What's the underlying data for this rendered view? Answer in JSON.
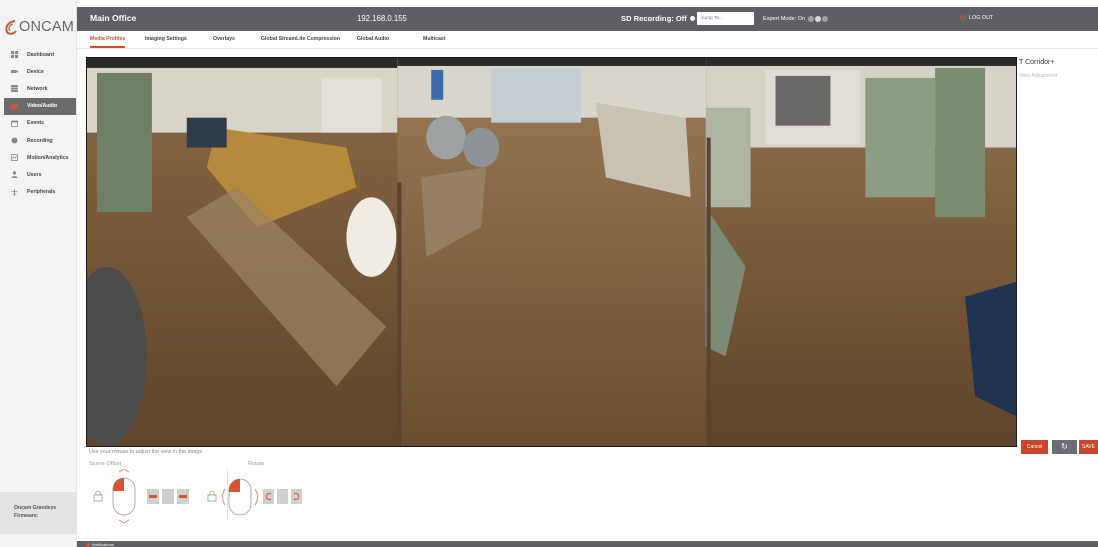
{
  "brand": {
    "logo_text": "ONCAM",
    "accent": "#cf4e2b"
  },
  "sidebar": {
    "items": [
      {
        "label": "Dashboard",
        "icon": "grid-icon",
        "active": false
      },
      {
        "label": "Device",
        "icon": "camera-icon",
        "active": false
      },
      {
        "label": "Network",
        "icon": "network-icon",
        "active": false
      },
      {
        "label": "Video/Audio",
        "icon": "video-icon",
        "active": true
      },
      {
        "label": "Events",
        "icon": "calendar-icon",
        "active": false
      },
      {
        "label": "Recording",
        "icon": "record-icon",
        "active": false
      },
      {
        "label": "Motion/Analytics",
        "icon": "motion-icon",
        "active": false
      },
      {
        "label": "Users",
        "icon": "user-icon",
        "active": false
      },
      {
        "label": "Peripherals",
        "icon": "peripherals-icon",
        "active": false
      }
    ],
    "footer": {
      "device_label": "Oncam Grandeye",
      "firmware_label": "Firmware:"
    }
  },
  "header": {
    "site_name": "Main Office",
    "ip_address": "192.168.0.155",
    "sd_recording": "SD Recording: Off",
    "jump_placeholder": "Jump To...",
    "expert_mode": "Expert Mode: On",
    "logout": "LOG OUT"
  },
  "tabs": [
    {
      "label": "Media Profiles",
      "active": true
    },
    {
      "label": "Imaging Settings",
      "active": false
    },
    {
      "label": "Overlays",
      "active": false
    },
    {
      "label": "Global StreamLite Compression",
      "active": false
    },
    {
      "label": "Global Audio",
      "active": false
    },
    {
      "label": "Multicast",
      "active": false
    }
  ],
  "right_panel": {
    "profile_name": "T Corridor+",
    "view_adjustment": "View Adjustment",
    "cancel": "Cancel",
    "refresh_icon": "refresh-icon",
    "save": "SAVE"
  },
  "controls": {
    "hint": "Use your mouse to adjust the view in the image",
    "scene_offset": "Scene Offset",
    "rotate": "Rotate"
  },
  "footer": {
    "notifications": "Notifications"
  }
}
